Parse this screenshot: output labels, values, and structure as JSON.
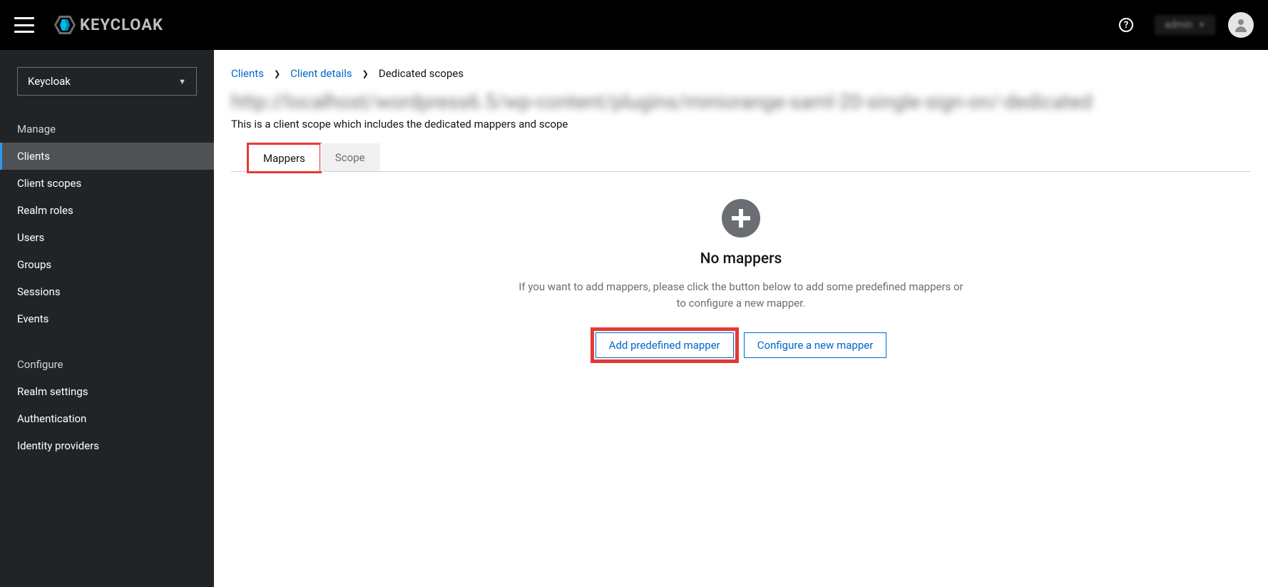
{
  "header": {
    "brand": "KEYCLOAK",
    "username": "admin"
  },
  "sidebar": {
    "realm_selected": "Keycloak",
    "sections": [
      {
        "title": "Manage",
        "items": [
          "Clients",
          "Client scopes",
          "Realm roles",
          "Users",
          "Groups",
          "Sessions",
          "Events"
        ],
        "active_index": 0
      },
      {
        "title": "Configure",
        "items": [
          "Realm settings",
          "Authentication",
          "Identity providers"
        ],
        "active_index": -1
      }
    ]
  },
  "breadcrumb": {
    "items": [
      "Clients",
      "Client details",
      "Dedicated scopes"
    ]
  },
  "page": {
    "title_blurred": "http://localhost/wordpress6.5/wp-content/plugins/miniorange-saml-20-single-sign-on/-dedicated",
    "subtitle": "This is a client scope which includes the dedicated mappers and scope"
  },
  "tabs": {
    "items": [
      "Mappers",
      "Scope"
    ],
    "active_index": 0
  },
  "empty": {
    "title": "No mappers",
    "description": "If you want to add mappers, please click the button below to add some predefined mappers or to configure a new mapper.",
    "primary_label": "Add predefined mapper",
    "secondary_label": "Configure a new mapper"
  }
}
